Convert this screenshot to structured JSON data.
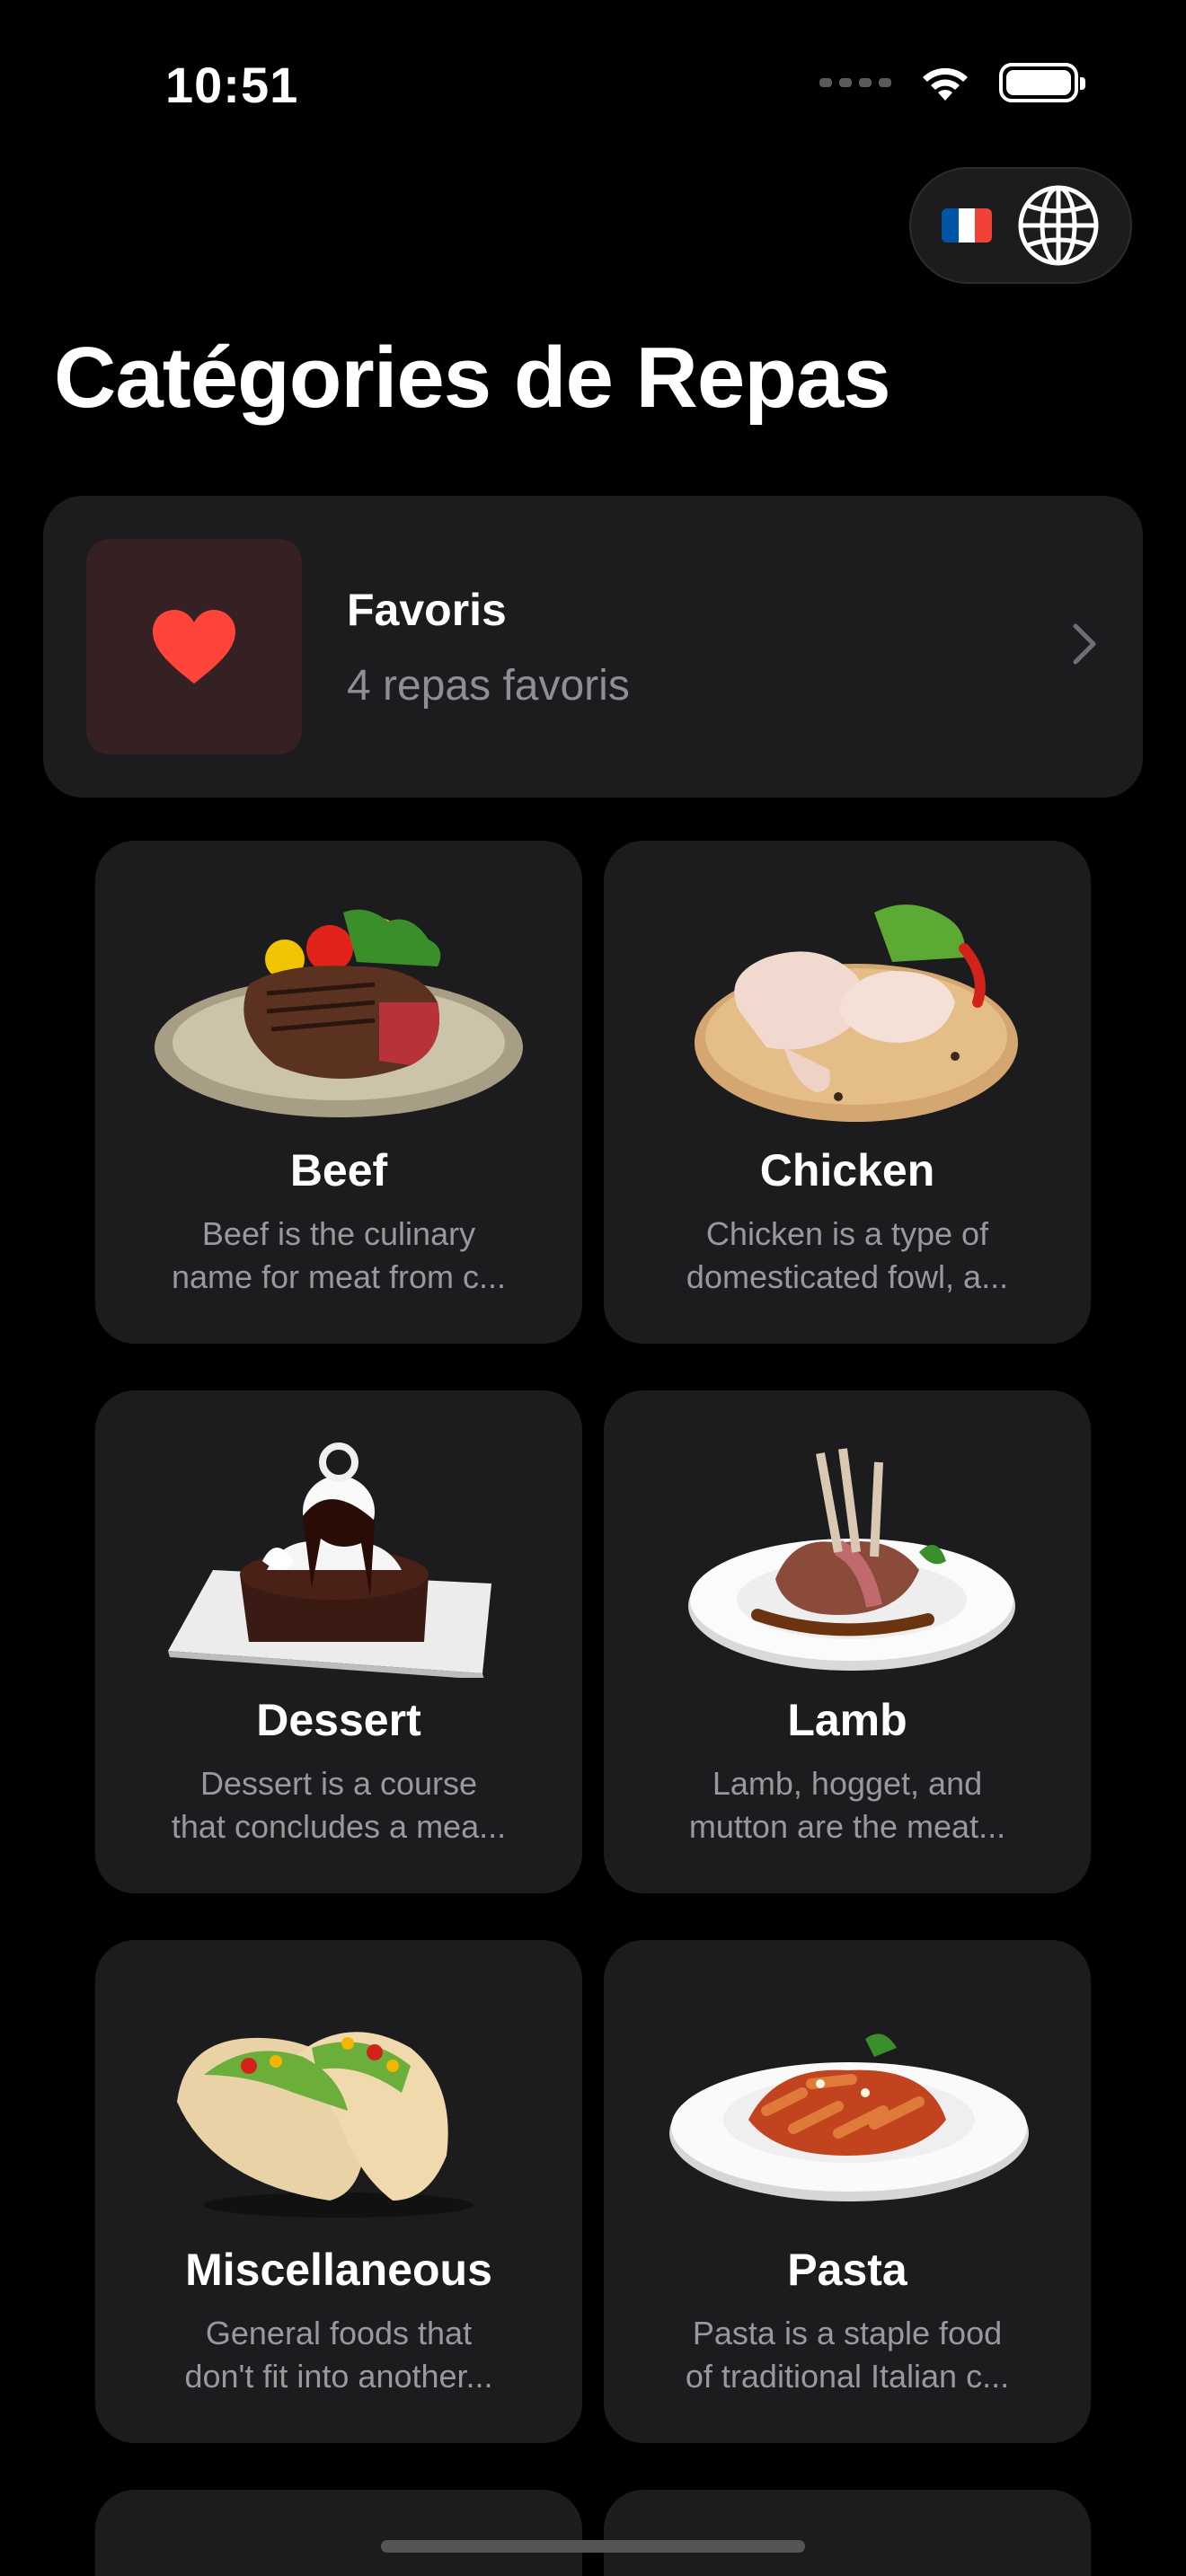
{
  "status": {
    "time": "10:51"
  },
  "language": {
    "flag_colors": [
      "#0055A4",
      "#FFFFFF",
      "#EF4135"
    ],
    "icon": "globe-icon"
  },
  "page": {
    "title": "Catégories de Repas"
  },
  "favorites": {
    "title": "Favoris",
    "subtitle": "4 repas favoris",
    "icon": "heart-icon",
    "accent": "#FF453A"
  },
  "categories": [
    {
      "name": "Beef",
      "line1": "Beef is the culinary",
      "line2": "name for meat from c..."
    },
    {
      "name": "Chicken",
      "line1": "Chicken is a type of",
      "line2": "domesticated fowl, a..."
    },
    {
      "name": "Dessert",
      "line1": "Dessert is a course",
      "line2": "that concludes a mea..."
    },
    {
      "name": "Lamb",
      "line1": "Lamb, hogget, and",
      "line2": "mutton are the meat..."
    },
    {
      "name": "Miscellaneous",
      "line1": "General foods that",
      "line2": "don't fit into another..."
    },
    {
      "name": "Pasta",
      "line1": "Pasta is a staple food",
      "line2": "of traditional Italian c..."
    }
  ]
}
